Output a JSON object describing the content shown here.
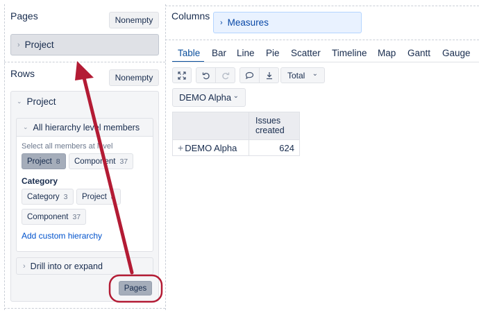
{
  "pages": {
    "title": "Pages",
    "nonempty_label": "Nonempty",
    "dimension_label": "Project"
  },
  "rows": {
    "title": "Rows",
    "nonempty_label": "Nonempty",
    "dimension_label": "Project",
    "hierarchy_header": "All hierarchy level members",
    "select_all_label": "Select all members at level",
    "levels": [
      {
        "label": "Project",
        "count": "8",
        "selected": true
      },
      {
        "label": "Component",
        "count": "37",
        "selected": false
      }
    ],
    "category_title": "Category",
    "category_levels": [
      {
        "label": "Category",
        "count": "3"
      },
      {
        "label": "Project",
        "count": "8"
      },
      {
        "label": "Component",
        "count": "37"
      }
    ],
    "add_custom_label": "Add custom hierarchy",
    "drill_label": "Drill into or expand",
    "pages_button_label": "Pages"
  },
  "columns": {
    "title": "Columns",
    "dimension_label": "Measures"
  },
  "tabs": [
    "Table",
    "Bar",
    "Line",
    "Pie",
    "Scatter",
    "Timeline",
    "Map",
    "Gantt",
    "Gauge"
  ],
  "active_tab": "Table",
  "toolbar": {
    "total_label": "Total",
    "icons": [
      "expand-icon",
      "undo-icon",
      "redo-icon",
      "comment-icon",
      "download-icon"
    ]
  },
  "page_selector": {
    "value": "DEMO Alpha"
  },
  "report_table": {
    "column_header": "Issues created",
    "rows": [
      {
        "label": "DEMO Alpha",
        "value": "624"
      }
    ]
  },
  "colors": {
    "annotation": "#b31b34",
    "accent": "#0052cc",
    "active_tab": "#0b4f9c"
  }
}
